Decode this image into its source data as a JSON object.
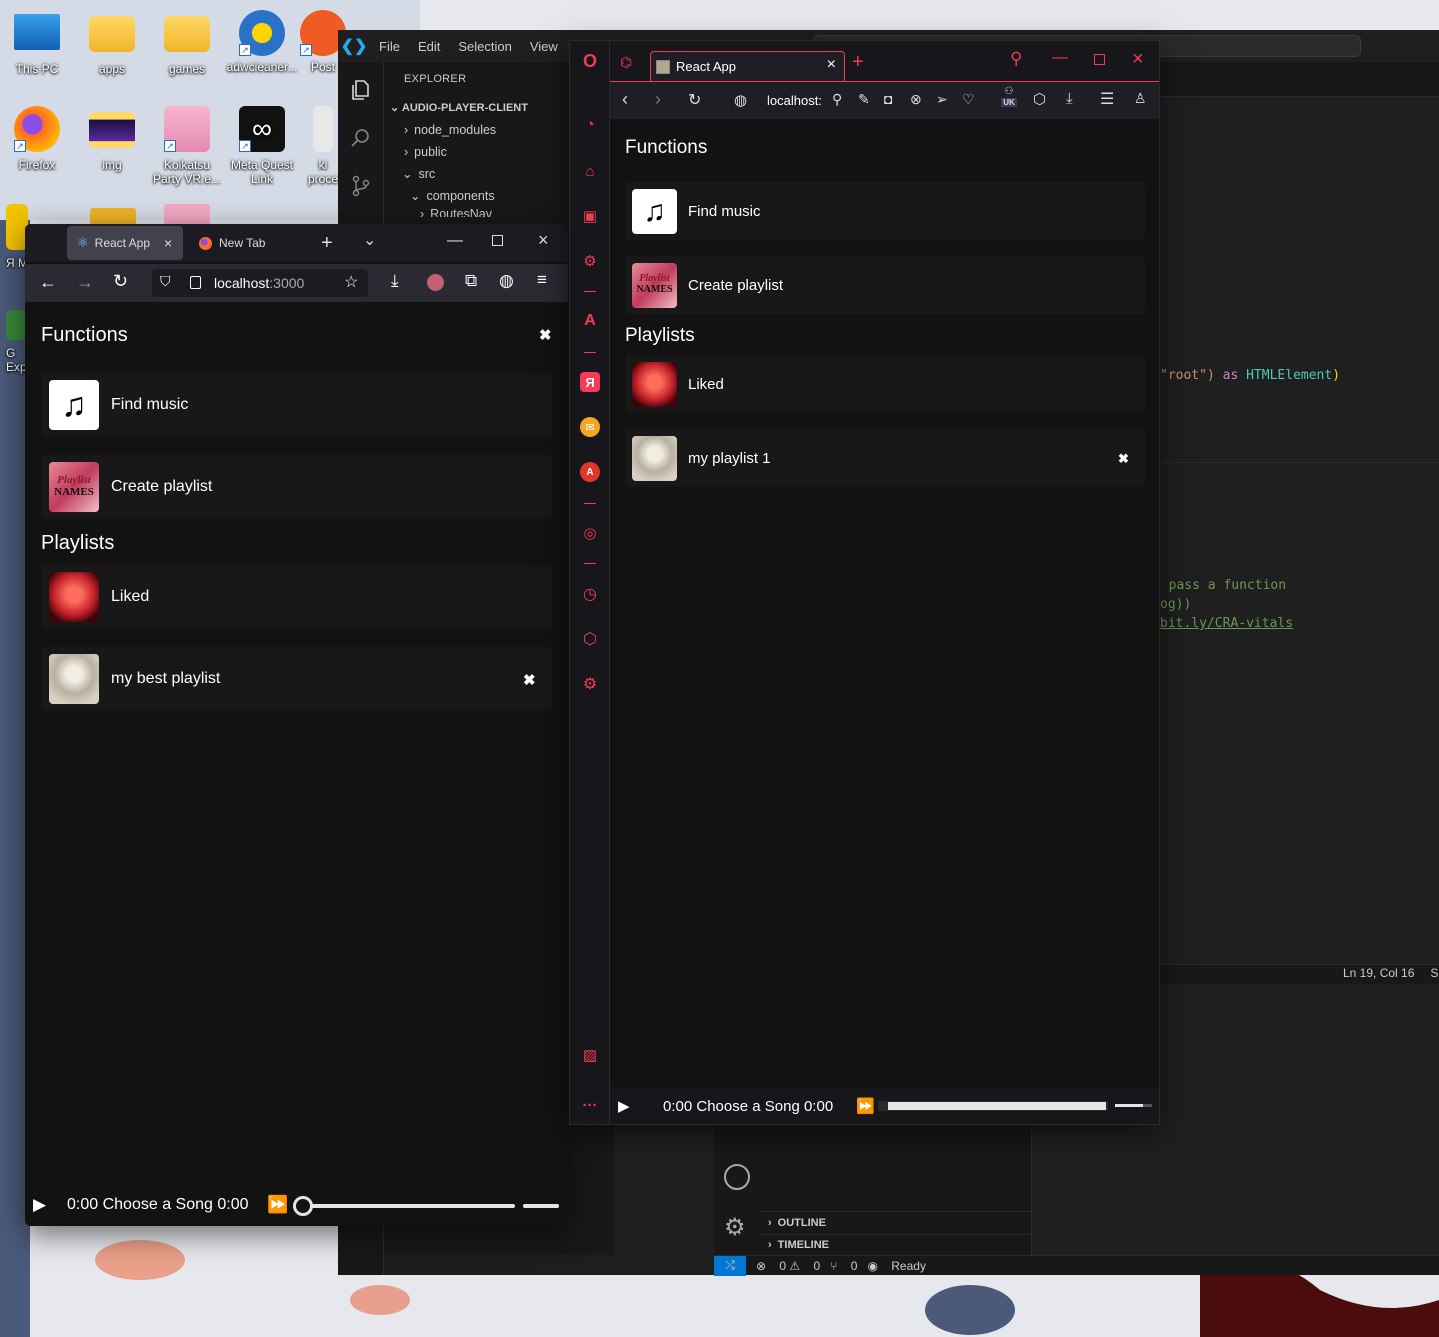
{
  "desktop": {
    "icons": [
      {
        "label": "This PC",
        "icon": "this-pc-icon"
      },
      {
        "label": "apps",
        "icon": "folder-icon"
      },
      {
        "label": "games",
        "icon": "folder-icon"
      },
      {
        "label": "adwcleaner...",
        "icon": "adwcleaner-icon"
      },
      {
        "label": "Post",
        "icon": "postman-icon"
      },
      {
        "label": "Firefox",
        "icon": "firefox-icon"
      },
      {
        "label": "img",
        "icon": "folder-icon"
      },
      {
        "label": "Koikatsu Party VR.e...",
        "icon": "koikatsu-icon"
      },
      {
        "label": "Meta Quest Link",
        "icon": "meta-icon"
      },
      {
        "label": "ki proce",
        "icon": "file-icon"
      },
      {
        "label": "Я M",
        "icon": "app-icon"
      },
      {
        "label": "G Exp",
        "icon": "app-icon"
      }
    ]
  },
  "vscode": {
    "menu": [
      "File",
      "Edit",
      "Selection",
      "View",
      "G"
    ],
    "explorer_header": "EXPLORER",
    "project": "AUDIO-PLAYER-CLIENT",
    "tree": [
      {
        "label": "node_modules",
        "depth": 1,
        "open": false
      },
      {
        "label": "public",
        "depth": 1,
        "open": false
      },
      {
        "label": "src",
        "depth": 1,
        "open": true
      },
      {
        "label": "components",
        "depth": 2,
        "open": true
      },
      {
        "label": "RoutesNav",
        "depth": 3,
        "open": false
      }
    ],
    "code_line_1_a": "\"root\")",
    "code_line_1_b": " as ",
    "code_line_1_c": "HTMLElement",
    "code_line_1_d": ")",
    "code_line_2": ", pass a function",
    "code_line_3": "og))",
    "code_line_4": "bit.ly/CRA-vitals",
    "line_col": "Ln 19, Col 16",
    "status_extra": "S",
    "panel_outline": "OUTLINE",
    "panel_timeline": "TIMELINE",
    "status_errors": "0",
    "status_warnings": "0",
    "status_ports": "0",
    "status_ready": "Ready"
  },
  "firefox": {
    "tabs": [
      {
        "title": "React App",
        "active": true
      },
      {
        "title": "New Tab",
        "active": false
      }
    ],
    "url_host": "localhost",
    "url_port": ":3000",
    "app": {
      "functions_title": "Functions",
      "functions": [
        "Find music",
        "Create playlist"
      ],
      "playlists_title": "Playlists",
      "playlists": [
        "Liked",
        "my best playlist"
      ]
    },
    "player": {
      "current_time": "0:00",
      "song": "Choose a Song",
      "duration": "0:00",
      "progress": 0,
      "volume": 1
    }
  },
  "opera": {
    "tab_title": "React App",
    "url": "localhost:",
    "vpn_badge": "UK",
    "app": {
      "functions_title": "Functions",
      "functions": [
        "Find music",
        "Create playlist"
      ],
      "playlists_title": "Playlists",
      "playlists": [
        "Liked",
        "my playlist 1"
      ]
    },
    "player": {
      "current_time": "0:00",
      "song": "Choose a Song",
      "duration": "0:00",
      "progress": 0,
      "volume": 1
    }
  },
  "colors": {
    "opera_accent": "#f43a56",
    "vscode_blue": "#0078d4",
    "card_bg": "#181818",
    "app_bg": "#121212"
  }
}
